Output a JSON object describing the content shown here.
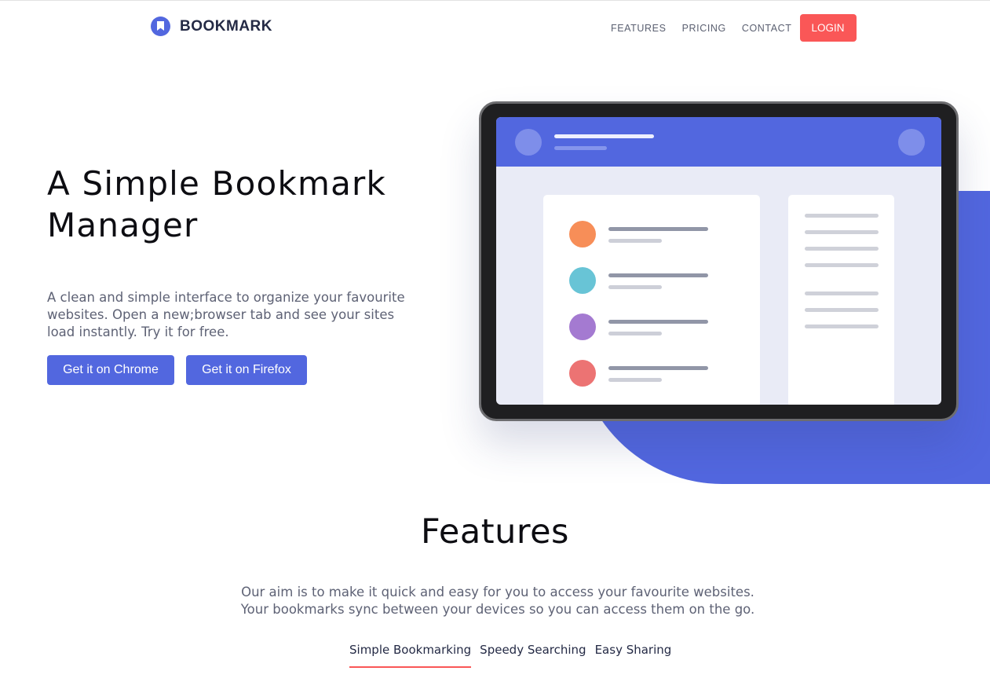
{
  "brand": {
    "name": "BOOKMARK",
    "icon": "bookmark-icon",
    "color": "#5267DF"
  },
  "nav": {
    "items": [
      "FEATURES",
      "PRICING",
      "CONTACT"
    ],
    "login_label": "LOGIN",
    "login_color": "#FA5757"
  },
  "hero": {
    "title_line1": "A Simple Bookmark",
    "title_line2": "Manager",
    "description": "A clean and simple interface to organize your favourite websites. Open a new;browser tab and see your sites load instantly. Try it for free.",
    "chrome_button": "Get it on Chrome",
    "firefox_button": "Get it on Firefox"
  },
  "features": {
    "title": "Features",
    "description_line1": "Our aim is to make it quick and easy for you to access your favourite websites.",
    "description_line2": "Your bookmarks sync between your devices so you can access them on the go.",
    "tabs": [
      "Simple Bookmarking",
      "Speedy Searching",
      "Easy Sharing"
    ],
    "active_tab": "Simple Bookmarking"
  },
  "illustration": {
    "dot_colors": [
      "#F78E58",
      "#68C4D6",
      "#A47AD1",
      "#EC7373"
    ]
  }
}
